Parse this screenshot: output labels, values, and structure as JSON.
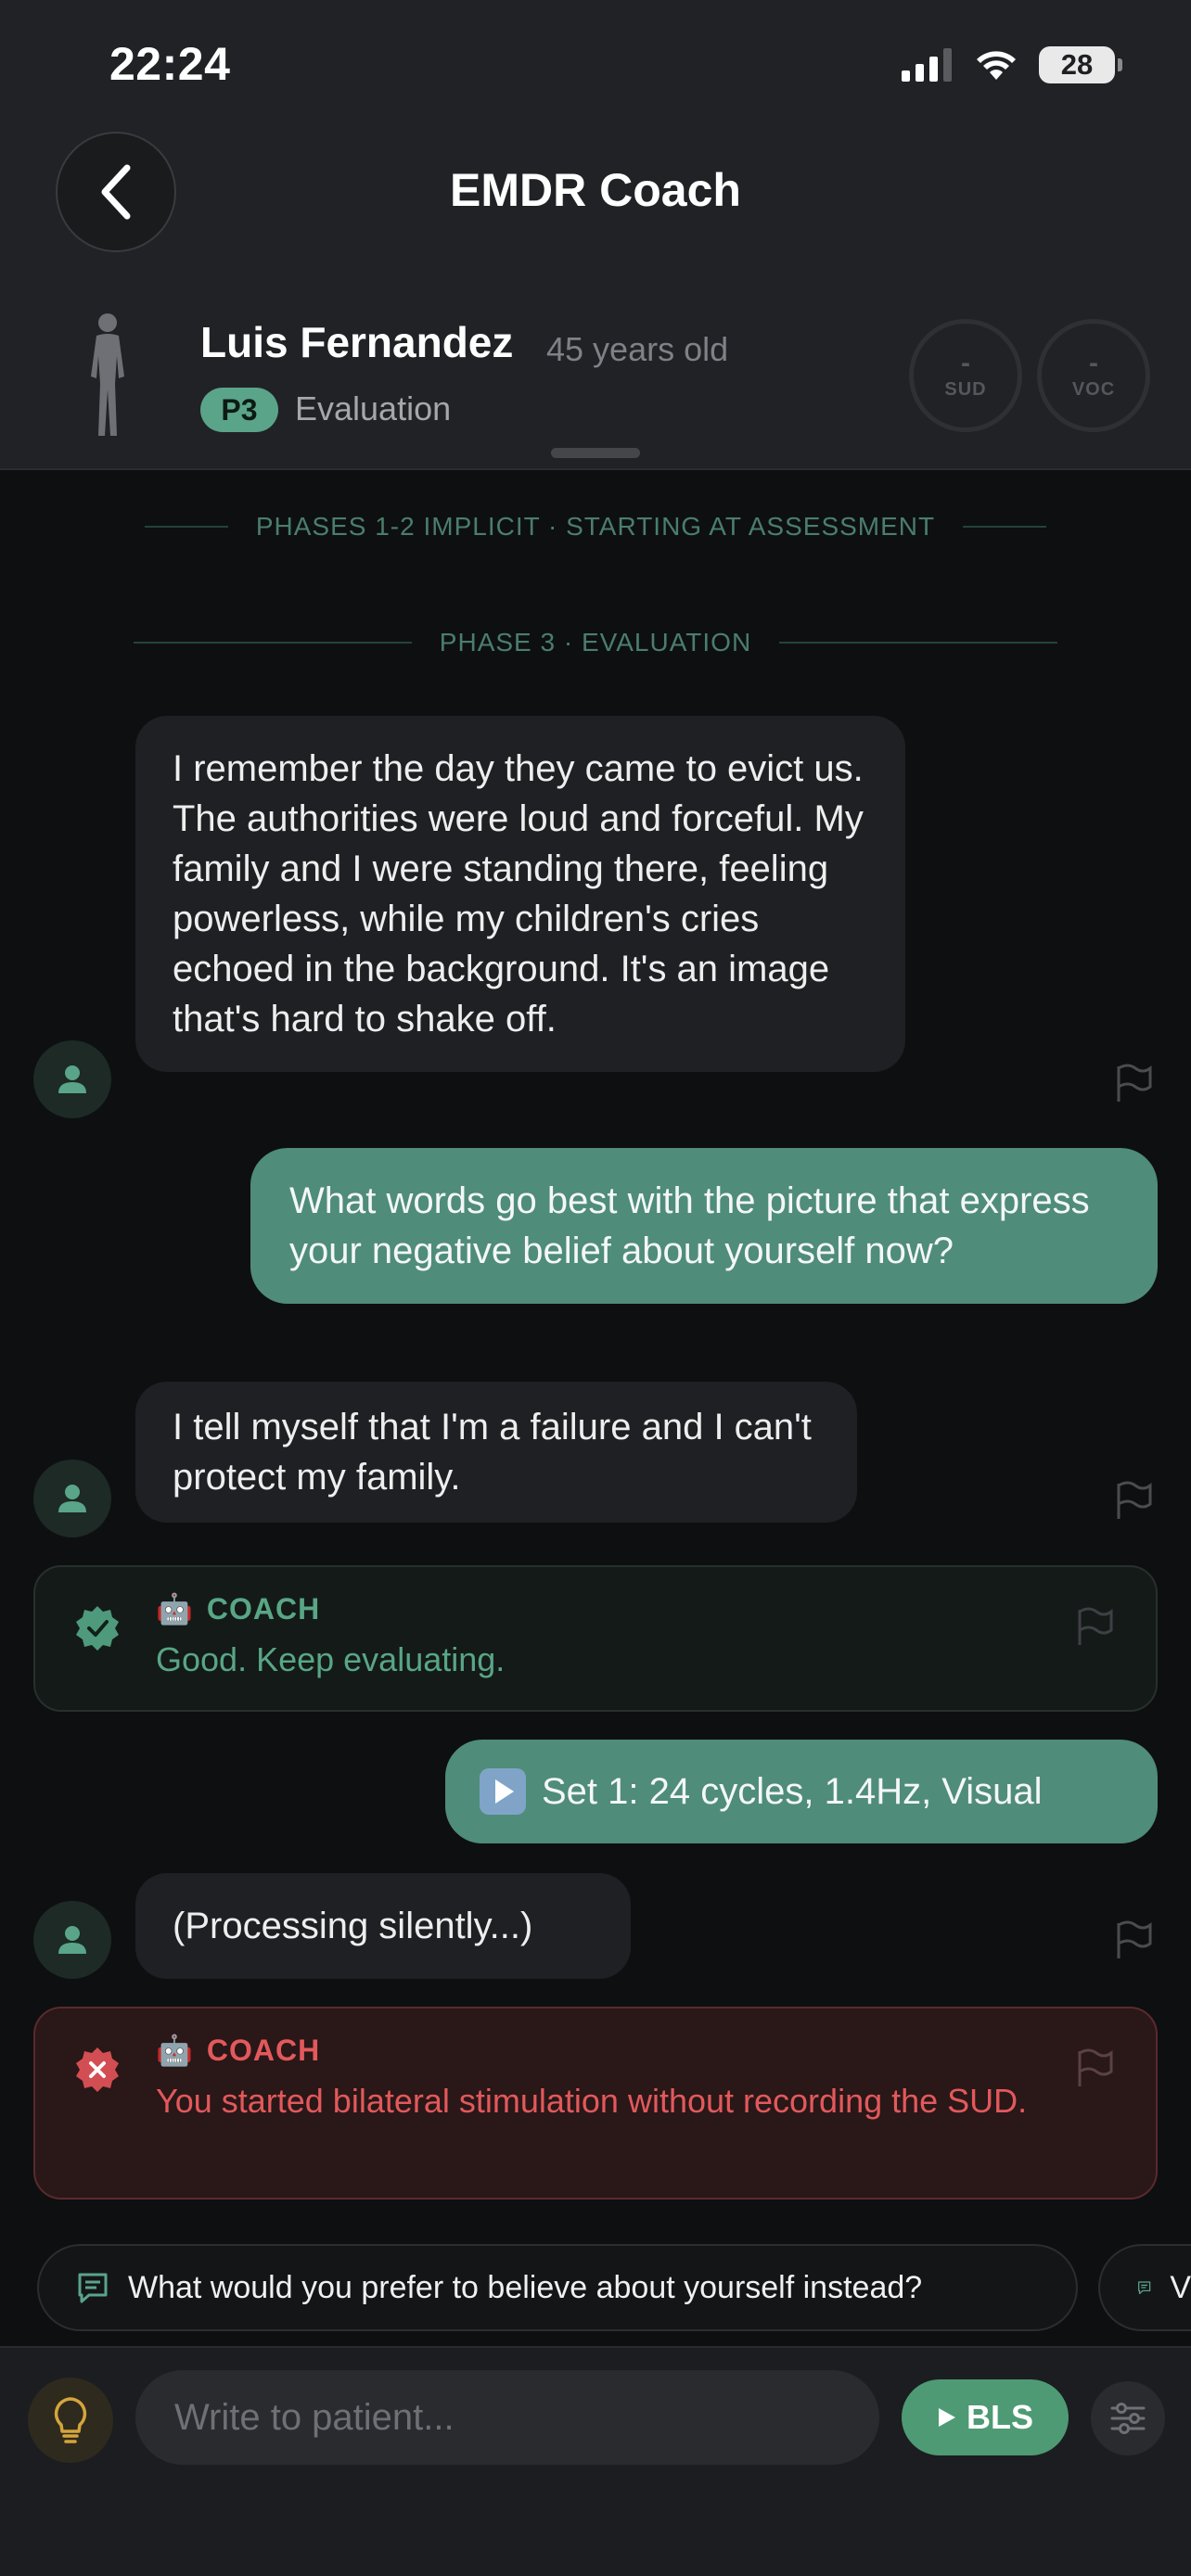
{
  "status_bar": {
    "time": "22:24",
    "battery": "28"
  },
  "header": {
    "title": "EMDR Coach"
  },
  "patient": {
    "name": "Luis Fernandez",
    "age": "45 years old",
    "phase_badge": "P3",
    "phase_label": "Evaluation",
    "sud": {
      "value": "-",
      "label": "SUD"
    },
    "voc": {
      "value": "-",
      "label": "VOC"
    }
  },
  "dividers": {
    "implicit": "PHASES 1-2 IMPLICIT · STARTING AT ASSESSMENT",
    "phase3": "PHASE 3 · EVALUATION"
  },
  "messages": {
    "patient_1": "I remember the day they came to evict us. The authorities were loud and forceful. My family and I were standing there, feeling powerless, while my children's cries echoed in the background. It's an image that's hard to shake off.",
    "therapist_1": "What words go best with the picture that express your negative belief about yourself now?",
    "patient_2": "I tell myself that I'm a failure and I can't protect my family.",
    "coach_1": {
      "label": "COACH",
      "text": "Good. Keep evaluating."
    },
    "therapist_2": "Set 1: 24 cycles, 1.4Hz, Visual",
    "patient_3": "(Processing silently...)",
    "coach_2": {
      "label": "COACH",
      "text": "You started bilateral stimulation without recording the SUD."
    }
  },
  "suggestions": [
    "What would you prefer to believe about yourself instead?",
    "V"
  ],
  "composer": {
    "placeholder": "Write to patient...",
    "bls_label": "BLS"
  },
  "colors": {
    "accent": "#4f8c7a",
    "success": "#58a686",
    "error": "#e2595b",
    "background": "#0e0f11"
  }
}
